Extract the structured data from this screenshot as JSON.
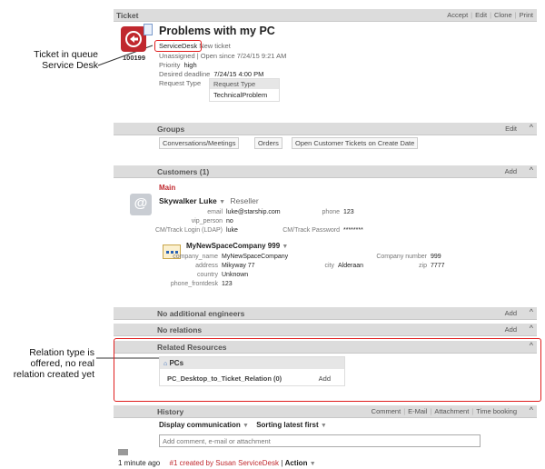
{
  "annotations": {
    "queue": "Ticket in queue Service Desk",
    "relation": "Relation type is offered, no real relation created yet"
  },
  "ticket_bar": {
    "title": "Ticket",
    "actions": [
      "Accept",
      "Edit",
      "Clone",
      "Print"
    ]
  },
  "ticket": {
    "id": "100199",
    "title": "Problems with my PC",
    "queue": "ServiceDesk",
    "state": "New ticket",
    "status_line": "Unassigned | Open since 7/24/15 9:21 AM",
    "priority_label": "Priority",
    "priority_value": "high",
    "deadline_label": "Desired deadline",
    "deadline_value": "7/24/15 4:00 PM",
    "request_type_label": "Request Type",
    "request_type_header": "Request Type",
    "request_type_value": "TechnicalProblem"
  },
  "groups": {
    "title": "Groups",
    "action": "Edit",
    "items": [
      "Conversations/Meetings",
      "Orders",
      "Open Customer Tickets on Create Date"
    ]
  },
  "customers": {
    "title": "Customers (1)",
    "action": "Add",
    "section": "Main",
    "person": "Skywalker Luke",
    "role": "Reseller",
    "email_label": "email",
    "email_value": "luke@starship.com",
    "phone_label": "phone",
    "phone_value": "123",
    "vip_label": "vip_person",
    "vip_value": "no",
    "login_label": "CM/Track Login (LDAP)",
    "login_value": "luke",
    "password_label": "CM/Track Password",
    "password_value": "********",
    "company": "MyNewSpaceCompany 999",
    "company_name_label": "company_name",
    "company_name_value": "MyNewSpaceCompany",
    "company_number_label": "Company number",
    "company_number_value": "999",
    "address_label": "address",
    "address_value": "Mikyway 77",
    "city_label": "city",
    "city_value": "Alderaan",
    "zip_label": "zip",
    "zip_value": "7777",
    "country_label": "country",
    "country_value": "Unknown",
    "frontdesk_label": "phone_frontdesk",
    "frontdesk_value": "123"
  },
  "engineers": {
    "title": "No additional engineers",
    "action": "Add"
  },
  "relations": {
    "title": "No relations",
    "action": "Add"
  },
  "related": {
    "title": "Related Resources",
    "group": "PCs",
    "relation": "PC_Desktop_to_Ticket_Relation (0)",
    "add": "Add"
  },
  "history": {
    "title": "History",
    "actions": [
      "Comment",
      "E-Mail",
      "Attachment",
      "Time booking"
    ],
    "display": "Display communication",
    "sorting": "Sorting latest first",
    "input_placeholder": "Add comment, e-mail or attachment",
    "entry_time": "1 minute ago",
    "entry_text": "#1 created by Susan ServiceDesk",
    "entry_sep": "|",
    "entry_action": "Action"
  },
  "colors": {
    "accent_red": "#c0282e",
    "highlight": "#e01e1e",
    "blue_icon": "#2a63b5"
  }
}
